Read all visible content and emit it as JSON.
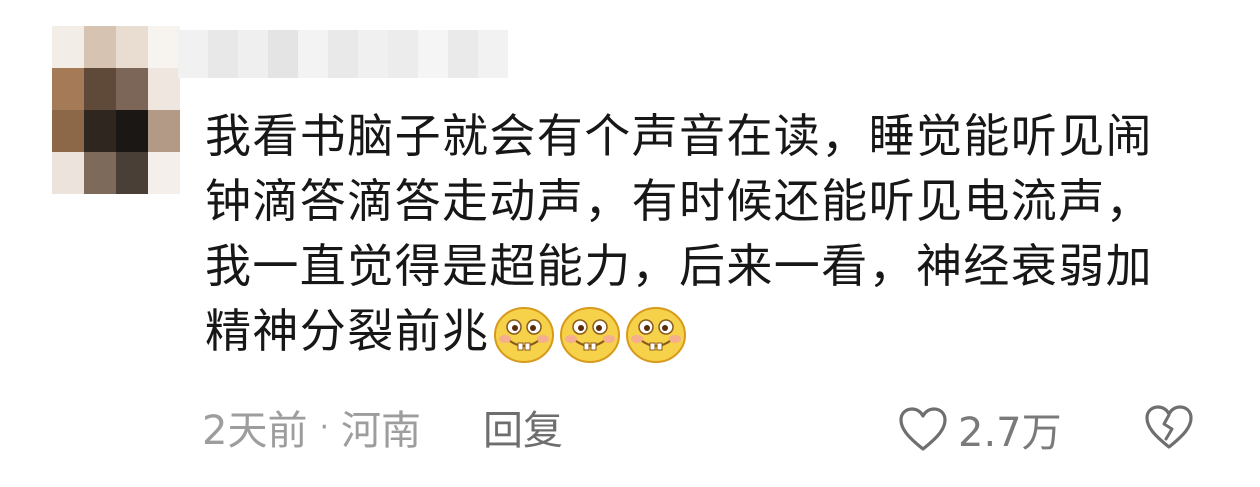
{
  "comment": {
    "lines": [
      "我看书脑子就会有个声音在读，睡觉能听见闹",
      "钟滴答滴答走动声，有时候还能听见电流声，",
      "我一直觉得是超能力，后来一看，神经衰弱加",
      "精神分裂前兆"
    ],
    "emoji_icons": [
      "buck-tooth-grin-emoji-icon",
      "buck-tooth-grin-emoji-icon",
      "buck-tooth-grin-emoji-icon"
    ],
    "time": "2天前",
    "separator": "·",
    "location": "河南",
    "reply_label": "回复",
    "like_count": "2.7万"
  },
  "colors": {
    "text": "#171717",
    "meta": "#9d9d9d",
    "reply": "#6e6e6e",
    "emoji_face": "#f6d24a",
    "emoji_outline": "#d79a1c"
  }
}
